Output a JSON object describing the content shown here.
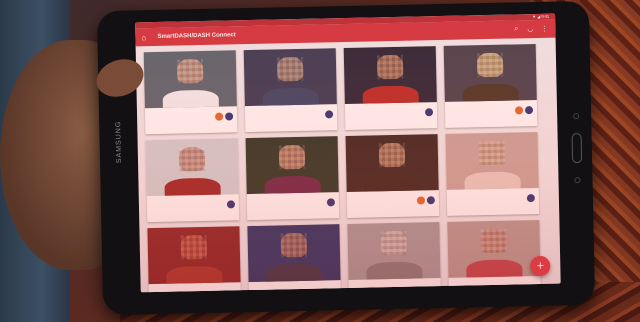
{
  "app": {
    "title": "SmartDASH/DASH Connect",
    "status_text": "▼ ◢ 9:41"
  },
  "toolbar": {
    "home_icon": "home-icon",
    "search_icon": "search-icon",
    "wifi_icon": "wifi-icon",
    "menu_icon": "more-vert-icon"
  },
  "device": {
    "brand": "SAMSUNG"
  },
  "cards": [
    {
      "name": "",
      "badges": [
        "orange",
        "blue"
      ],
      "bg": "#5a6a72",
      "face": "#c9a08a",
      "body": "#f2f2f2"
    },
    {
      "name": "",
      "badges": [
        "blue"
      ],
      "bg": "#3a3f58",
      "face": "#a8887a",
      "body": "#3c4a6a"
    },
    {
      "name": "",
      "badges": [
        "blue"
      ],
      "bg": "#2a2a3a",
      "face": "#b07a60",
      "body": "#b8302a"
    },
    {
      "name": "",
      "badges": [
        "orange",
        "blue"
      ],
      "bg": "#4a4650",
      "face": "#d0b080",
      "body": "#4a3a2a"
    },
    {
      "name": "",
      "badges": [
        "blue"
      ],
      "bg": "#d0d4d8",
      "face": "#c09080",
      "body": "#9a2a2a"
    },
    {
      "name": "",
      "badges": [
        "blue"
      ],
      "bg": "#2a3a2a",
      "face": "#c08a70",
      "body": "#6a2a4a"
    },
    {
      "name": "",
      "badges": [
        "orange",
        "blue"
      ],
      "bg": "#3a2a24",
      "face": "#b08060",
      "body": "#3a2a20"
    },
    {
      "name": "",
      "badges": [
        "blue"
      ],
      "bg": "#c8a8a0",
      "face": "#d0a890",
      "body": "#e8d0c8"
    },
    {
      "name": "",
      "badges": [],
      "bg": "#8a2a2a",
      "face": "#c05040",
      "body": "#a83a30"
    },
    {
      "name": "",
      "badges": [],
      "bg": "#2a3a6a",
      "face": "#a07060",
      "body": "#3a3a4a"
    },
    {
      "name": "",
      "badges": [],
      "bg": "#a8a0a0",
      "face": "#d0b8b0",
      "body": "#8a8080"
    },
    {
      "name": "",
      "badges": [],
      "bg": "#b8a098",
      "face": "#c89080",
      "body": "#c04a50"
    }
  ],
  "fab": {
    "label": "+"
  }
}
